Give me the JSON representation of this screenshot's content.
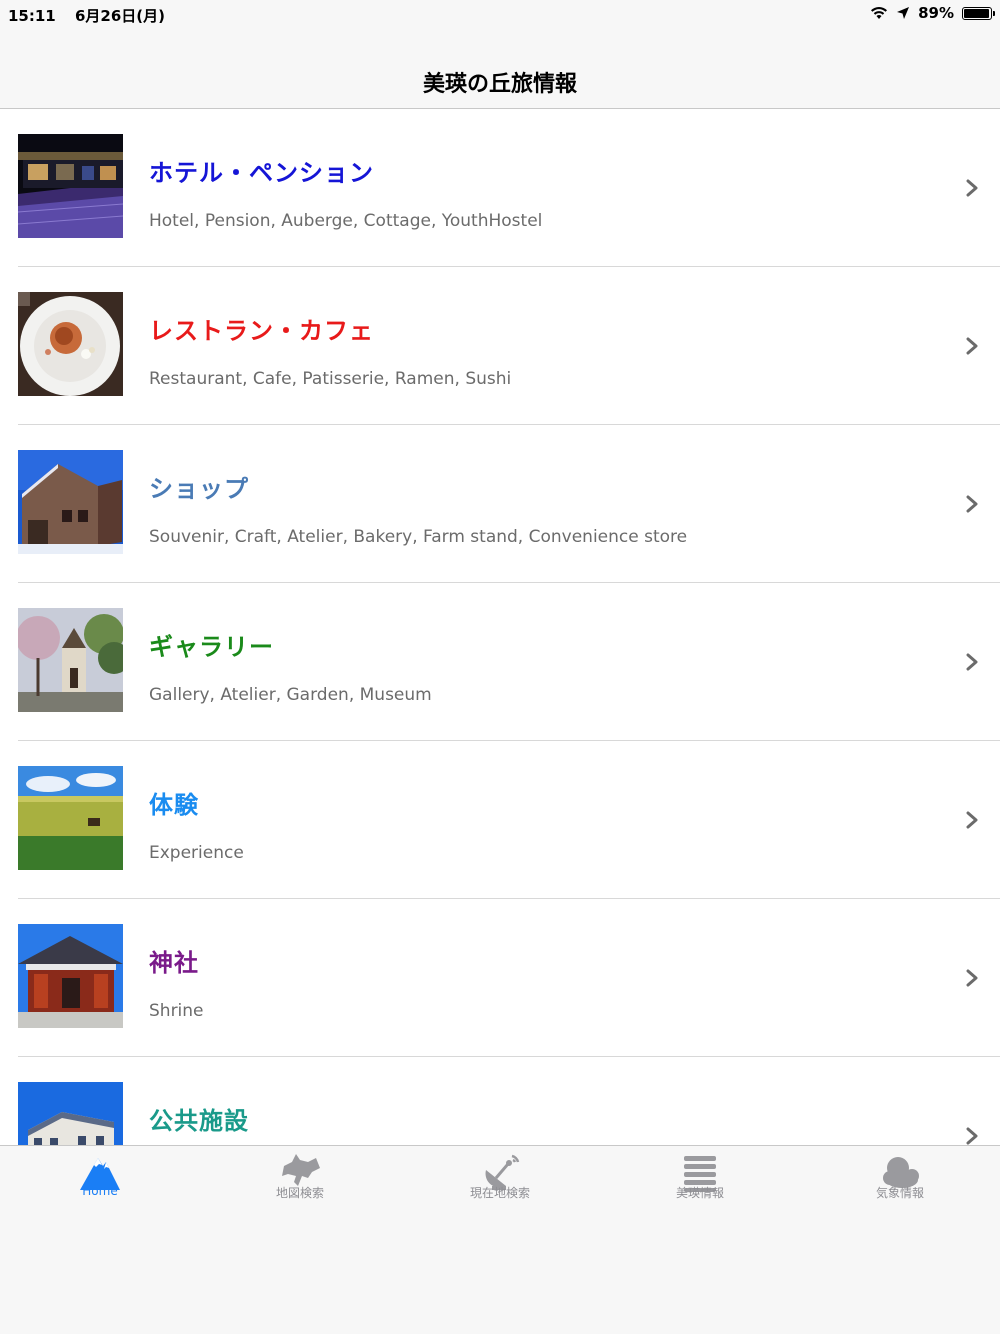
{
  "status_bar": {
    "time": "15:11",
    "date": "6月26日(月)",
    "battery": "89%"
  },
  "nav": {
    "title": "美瑛の丘旅情報"
  },
  "list": [
    {
      "title": "ホテル・ペンション",
      "subtitle": "Hotel, Pension, Auberge, Cottage, YouthHostel",
      "color": "#1515d6",
      "icon": "hotel-photo"
    },
    {
      "title": "レストラン・カフェ",
      "subtitle": "Restaurant, Cafe, Patisserie, Ramen, Sushi",
      "color": "#e81a1a",
      "icon": "restaurant-photo"
    },
    {
      "title": "ショップ",
      "subtitle": "Souvenir, Craft, Atelier, Bakery, Farm stand, Convenience store",
      "color": "#4a7bb5",
      "icon": "shop-photo"
    },
    {
      "title": "ギャラリー",
      "subtitle": "Gallery, Atelier, Garden, Museum",
      "color": "#1a8a1a",
      "icon": "gallery-photo"
    },
    {
      "title": "体験",
      "subtitle": "Experience",
      "color": "#1a8cf0",
      "icon": "experience-photo"
    },
    {
      "title": "神社",
      "subtitle": "Shrine",
      "color": "#7a1a8a",
      "icon": "shrine-photo"
    },
    {
      "title": "公共施設",
      "subtitle": "",
      "color": "#1a9a8a",
      "icon": "public-facility-photo"
    }
  ],
  "tabs": [
    {
      "label": "Home",
      "icon": "mountain-icon",
      "active": true
    },
    {
      "label": "地図検索",
      "icon": "hokkaido-map-icon",
      "active": false
    },
    {
      "label": "現在地検索",
      "icon": "satellite-dish-icon",
      "active": false
    },
    {
      "label": "美瑛情報",
      "icon": "list-icon",
      "active": false
    },
    {
      "label": "気象情報",
      "icon": "weather-icon",
      "active": false
    }
  ],
  "colors": {
    "accent": "#1a7ef5",
    "inactive": "#8e8e93",
    "separator": "#d8d8d8"
  }
}
